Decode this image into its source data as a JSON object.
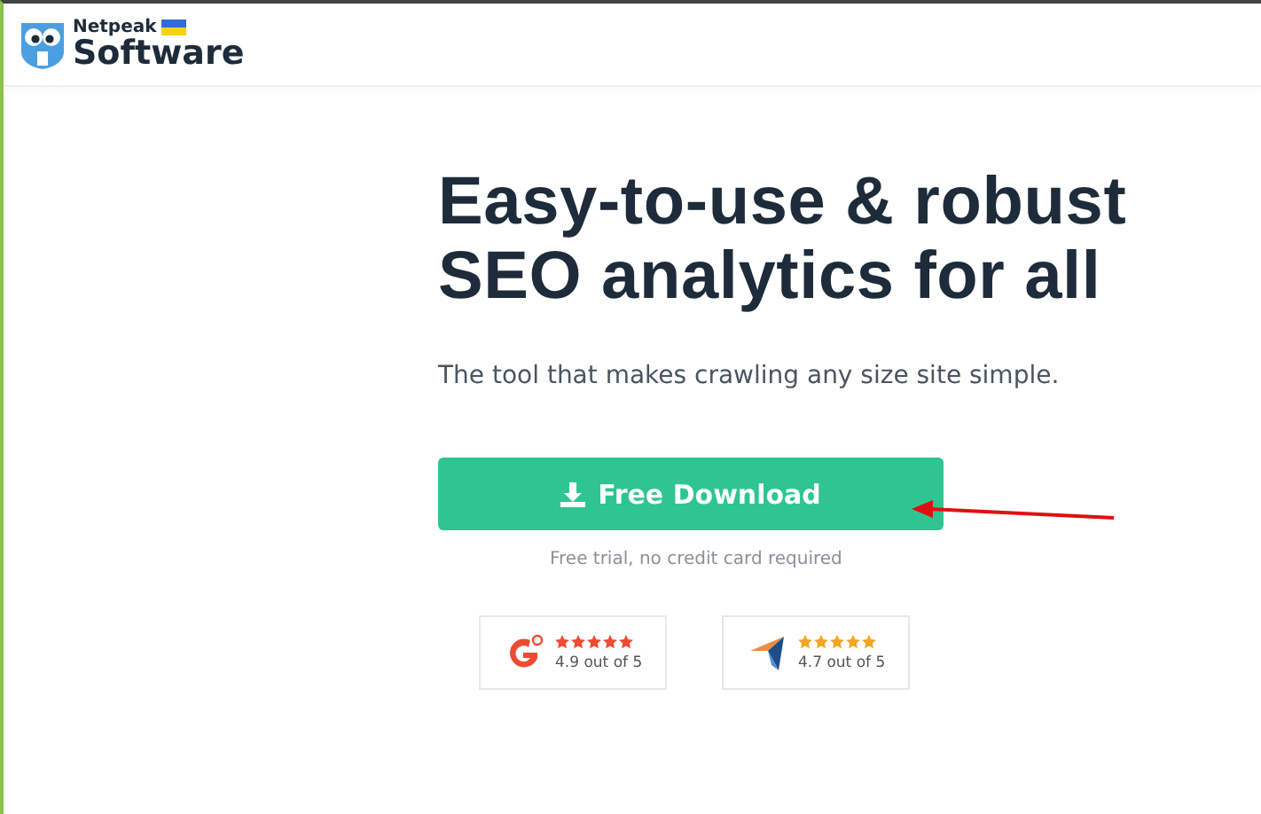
{
  "logo": {
    "top": "Netpeak",
    "bottom": "Software"
  },
  "hero": {
    "title_lines": [
      "Easy-to-use & robust",
      "SEO analytics for all"
    ],
    "subtitle": "The tool that makes crawling any size site simple.",
    "button": "Free Download",
    "note": "Free trial, no credit card required"
  },
  "ratings": [
    {
      "kind": "g2",
      "stars": 5,
      "text": "4.9 out of 5",
      "color": "#ef4b32"
    },
    {
      "kind": "capterra",
      "stars": 5,
      "text": "4.7 out of 5",
      "color": "#f5a623"
    }
  ]
}
